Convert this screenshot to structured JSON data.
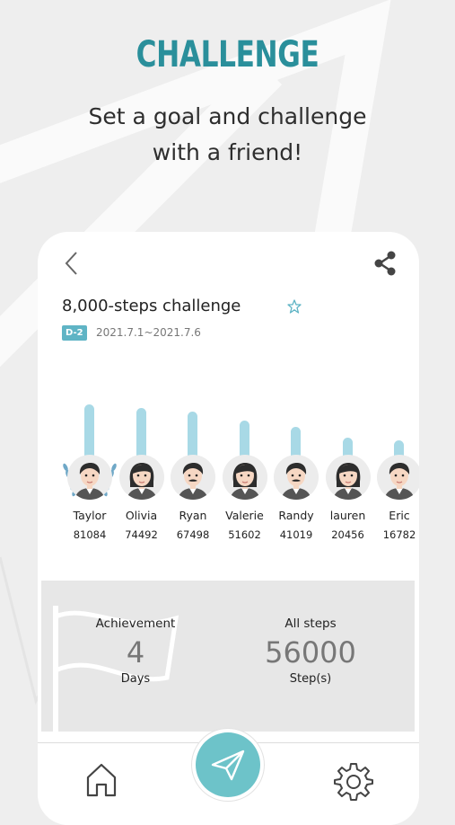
{
  "promo": {
    "title": "CHALLENGE",
    "subtitle_line1": "Set a goal and challenge",
    "subtitle_line2": "with a friend!"
  },
  "challenge": {
    "title": "8,000-steps challenge",
    "badge": "D-2",
    "dates": "2021.7.1~2021.7.6"
  },
  "participants": [
    {
      "name": "Taylor",
      "steps": "81084",
      "steps_value": 81084,
      "avatar": "man-avatar",
      "winner": true
    },
    {
      "name": "Olivia",
      "steps": "74492",
      "steps_value": 74492,
      "avatar": "woman-avatar"
    },
    {
      "name": "Ryan",
      "steps": "67498",
      "steps_value": 67498,
      "avatar": "mustache-man-avatar"
    },
    {
      "name": "Valerie",
      "steps": "51602",
      "steps_value": 51602,
      "avatar": "woman-avatar"
    },
    {
      "name": "Randy",
      "steps": "41019",
      "steps_value": 41019,
      "avatar": "mustache-man-avatar"
    },
    {
      "name": "lauren",
      "steps": "20456",
      "steps_value": 20456,
      "avatar": "woman-avatar"
    },
    {
      "name": "Eric",
      "steps": "16782",
      "steps_value": 16782,
      "avatar": "man-avatar"
    }
  ],
  "stats": {
    "achievement_label": "Achievement",
    "achievement_value": "4",
    "achievement_unit": "Days",
    "steps_label": "All steps",
    "steps_value": "56000",
    "steps_unit": "Step(s)"
  },
  "icons": {
    "back": "chevron-left-icon",
    "share": "share-icon",
    "favorite": "star-outline-icon",
    "home": "home-icon",
    "center": "paper-plane-icon",
    "settings": "gear-icon"
  },
  "colors": {
    "accent": "#2a8f9b",
    "bar": "#a8d9e6",
    "badge": "#5fb4c5",
    "fab": "#6dc3c9"
  }
}
